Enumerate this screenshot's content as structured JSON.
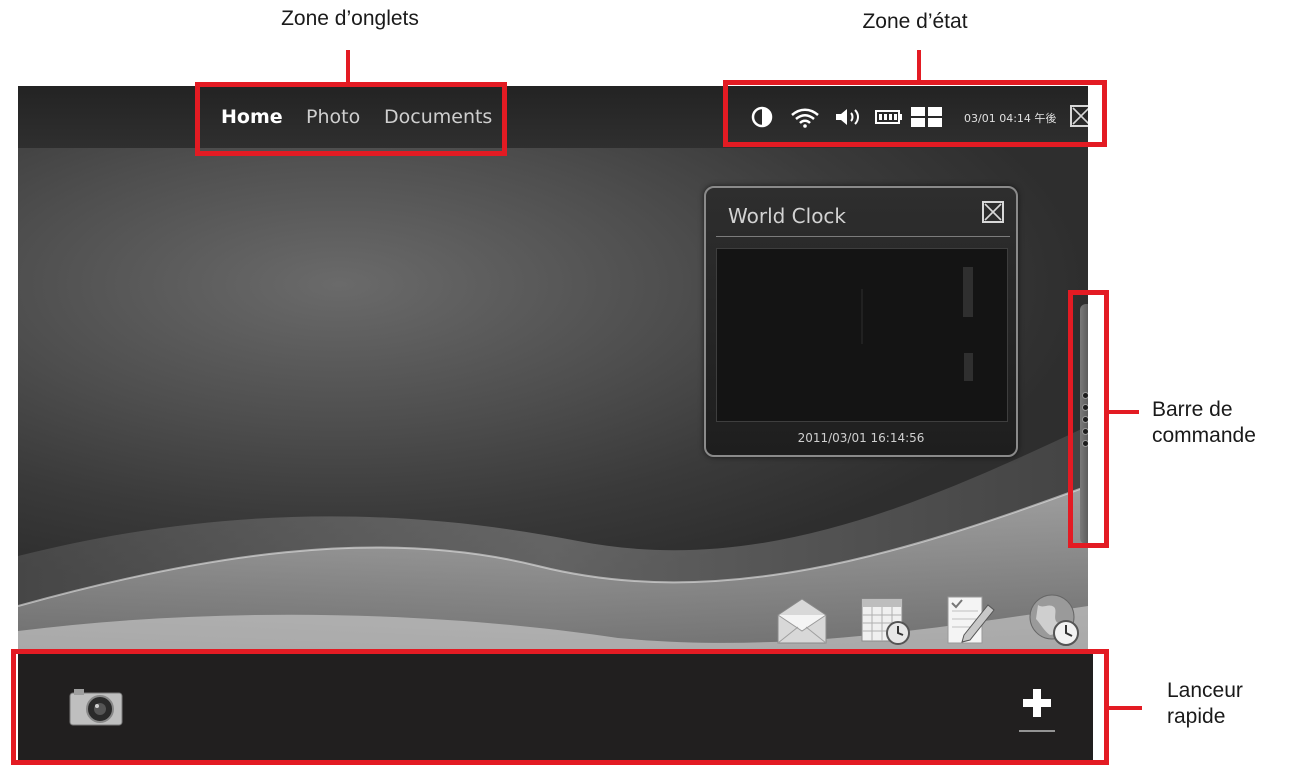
{
  "callouts": {
    "tabs_zone": "Zone d’onglets",
    "status_zone": "Zone d’état",
    "command_bar": "Barre de commande",
    "launcher": "Lanceur rapide"
  },
  "tabs": [
    {
      "label": "Home",
      "active": true
    },
    {
      "label": "Photo",
      "active": false
    },
    {
      "label": "Documents",
      "active": false
    }
  ],
  "status": {
    "icons": [
      "brightness-icon",
      "wifi-icon",
      "volume-icon",
      "battery-icon",
      "grid-icon"
    ],
    "datetime": "03/01 04:14 午後"
  },
  "world_clock": {
    "title": "World Clock",
    "date": "2011/03/01 16:14:56"
  },
  "apps": [
    "mail-icon",
    "calendar-icon",
    "notes-icon",
    "world-clock-icon"
  ],
  "launcher": {
    "items": [
      "camera-icon",
      "add-icon"
    ]
  },
  "colors": {
    "highlight": "#e31b23",
    "launcher_bg": "#211f1f",
    "topbar_bg": "#2a2a2a"
  }
}
